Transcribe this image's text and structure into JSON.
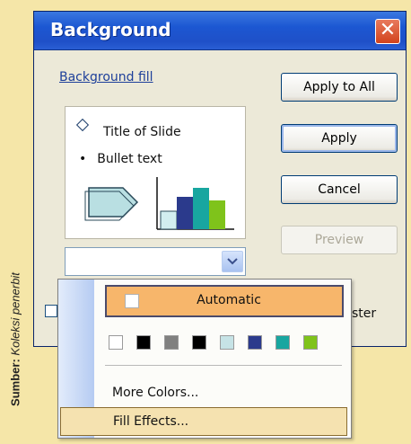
{
  "caption": {
    "bold": "Sumber:",
    "italic": "Koleksi penerbit"
  },
  "dialog": {
    "title": "Background",
    "close_symbol": "✕",
    "group_label": "Background fill",
    "preview": {
      "title": "Title of Slide",
      "bullet_symbol": "•",
      "bullet": "Bullet text"
    },
    "buttons": {
      "apply_all": "Apply to All",
      "apply": "Apply",
      "cancel": "Cancel",
      "preview": "Preview"
    },
    "master_label": "ster"
  },
  "popup": {
    "automatic": "Automatic",
    "swatch_colors": [
      "#ffffff",
      "#000000",
      "#808080",
      "#000000",
      "#c6e3e6",
      "#2b3a8c",
      "#18a6a0",
      "#7fc31b"
    ],
    "more_colors": "More Colors...",
    "fill_effects": "Fill Effects..."
  },
  "icons": {
    "close": "close-icon",
    "dropdown": "chevron-down-icon",
    "diamond": "diamond-bullet-icon"
  },
  "colors": {
    "title_bar": "#1c57d2",
    "dialog_bg": "#ece9d8",
    "highlight": "#f7b66b"
  }
}
